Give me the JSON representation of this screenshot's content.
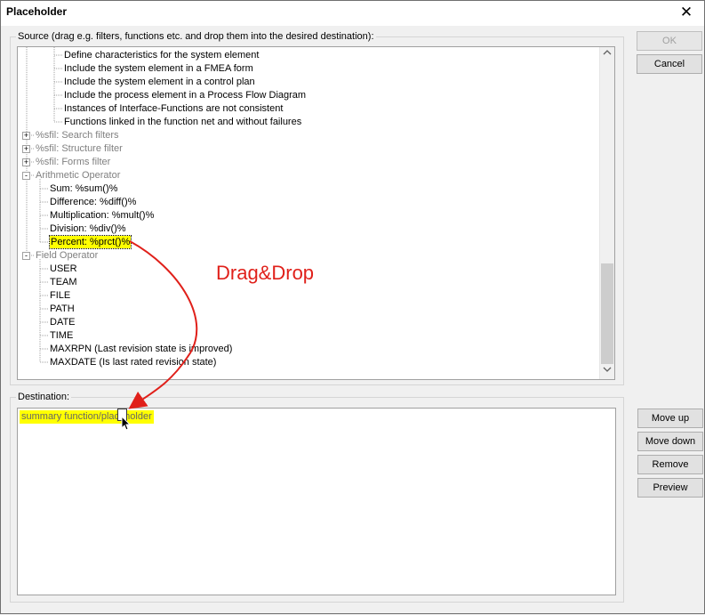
{
  "window": {
    "title": "Placeholder",
    "close_glyph": "✕"
  },
  "source": {
    "label": "Source (drag e.g. filters, functions etc. and drop them into the desired destination):",
    "items": [
      {
        "label": "Define characteristics for the system element",
        "style": "normal",
        "level": 3
      },
      {
        "label": "Include the system element in a FMEA form",
        "style": "normal",
        "level": 3
      },
      {
        "label": "Include the system element in a control plan",
        "style": "normal",
        "level": 3
      },
      {
        "label": "Include the process element in a Process Flow Diagram",
        "style": "normal",
        "level": 3
      },
      {
        "label": "Instances of Interface-Functions are not consistent",
        "style": "normal",
        "level": 3
      },
      {
        "label": "Functions linked in the function net and without failures",
        "style": "normal",
        "level": 3
      },
      {
        "label": "%sfil: Search filters",
        "style": "gray",
        "level": 1,
        "expander": "+"
      },
      {
        "label": "%sfil: Structure filter",
        "style": "gray",
        "level": 1,
        "expander": "+"
      },
      {
        "label": "%sfil: Forms filter",
        "style": "gray",
        "level": 1,
        "expander": "+"
      },
      {
        "label": "Arithmetic Operator",
        "style": "gray",
        "level": 1,
        "expander": "-"
      },
      {
        "label": "Sum: %sum()%",
        "style": "normal",
        "level": 2
      },
      {
        "label": "Difference: %diff()%",
        "style": "normal",
        "level": 2
      },
      {
        "label": "Multiplication: %mult()%",
        "style": "normal",
        "level": 2
      },
      {
        "label": "Division: %div()%",
        "style": "normal",
        "level": 2
      },
      {
        "label": "Percent: %prct()%",
        "style": "selected",
        "level": 2
      },
      {
        "label": "Field Operator",
        "style": "gray",
        "level": 1,
        "expander": "-"
      },
      {
        "label": "USER",
        "style": "normal",
        "level": 2
      },
      {
        "label": "TEAM",
        "style": "normal",
        "level": 2
      },
      {
        "label": "FILE",
        "style": "normal",
        "level": 2
      },
      {
        "label": "PATH",
        "style": "normal",
        "level": 2
      },
      {
        "label": "DATE",
        "style": "normal",
        "level": 2
      },
      {
        "label": "TIME",
        "style": "normal",
        "level": 2
      },
      {
        "label": "MAXRPN (Last revision state is improved)",
        "style": "normal",
        "level": 2
      },
      {
        "label": "MAXDATE (Is last rated revision state)",
        "style": "normal",
        "level": 2
      }
    ],
    "scroll_up_icon": "chevron-up-icon",
    "scroll_down_icon": "chevron-down-icon"
  },
  "destination": {
    "label": "Destination:",
    "item": "summary function/placeholder"
  },
  "buttons": {
    "ok": "OK",
    "cancel": "Cancel",
    "move_up": "Move up",
    "move_down": "Move down",
    "remove": "Remove",
    "preview": "Preview"
  },
  "annotation": {
    "text": "Drag&Drop",
    "color": "#e0201a"
  },
  "colors": {
    "highlight": "#ffff00",
    "arrow": "#e0201a"
  }
}
